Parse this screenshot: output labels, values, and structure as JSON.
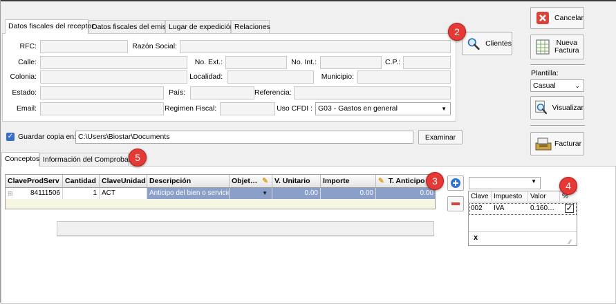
{
  "receptor_tabs": [
    "Datos fiscales del receptor",
    "Datos fiscales del emisor",
    "Lugar de expedición",
    "Relaciones"
  ],
  "form": {
    "rfc": "RFC:",
    "razon_social": "Razón Social:",
    "calle": "Calle:",
    "no_ext": "No. Ext.:",
    "no_int": "No. Int.:",
    "cp": "C.P.:",
    "colonia": "Colonia:",
    "localidad": "Localidad:",
    "municipio": "Municipio:",
    "estado": "Estado:",
    "pais": "País:",
    "referencia": "Referencia:",
    "email": "Email:",
    "regimen_fiscal": "Regimen Fiscal:",
    "uso_cfdi": "Uso CFDI :",
    "uso_cfdi_value": "G03 - Gastos en general"
  },
  "buttons": {
    "clientes": "Clientes",
    "cancelar": "Cancelar",
    "nueva_factura": "Nueva\nFactura",
    "visualizar": "Visualizar",
    "facturar": "Facturar",
    "examinar": "Examinar"
  },
  "plantilla": {
    "label": "Plantilla:",
    "value": "Casual"
  },
  "guardar": {
    "label": "Guardar copia en:",
    "path": "C:\\Users\\Biostar\\Documents",
    "checked": true
  },
  "lower_tabs": [
    "Conceptos",
    "Información del Comprobante"
  ],
  "grid": {
    "columns": [
      "ClaveProdServ",
      "Cantidad",
      "ClaveUnidad",
      "Descripción",
      "Objet…",
      "V. Unitario",
      "Importe",
      "T. Anticipo"
    ],
    "row": {
      "clave_prod_serv": "84111506",
      "cantidad": "1",
      "clave_unidad": "ACT",
      "descripcion": "Anticipo del bien o servicio",
      "objeto": "",
      "v_unitario": "0.00",
      "importe": "0.00",
      "t_anticipo": "0.00"
    }
  },
  "taxes": {
    "columns": [
      "Clave",
      "Impuesto",
      "Valor",
      "%"
    ],
    "row": {
      "clave": "002",
      "impuesto": "IVA",
      "valor": "0.160…",
      "checked": true
    },
    "close": "x"
  },
  "badges": [
    "2",
    "3",
    "4",
    "5"
  ],
  "colors": {
    "accent": "#3a6fc8",
    "badge": "#e53935",
    "selection": "#8aa0c8",
    "grid_bg": "#f6f6e2"
  }
}
